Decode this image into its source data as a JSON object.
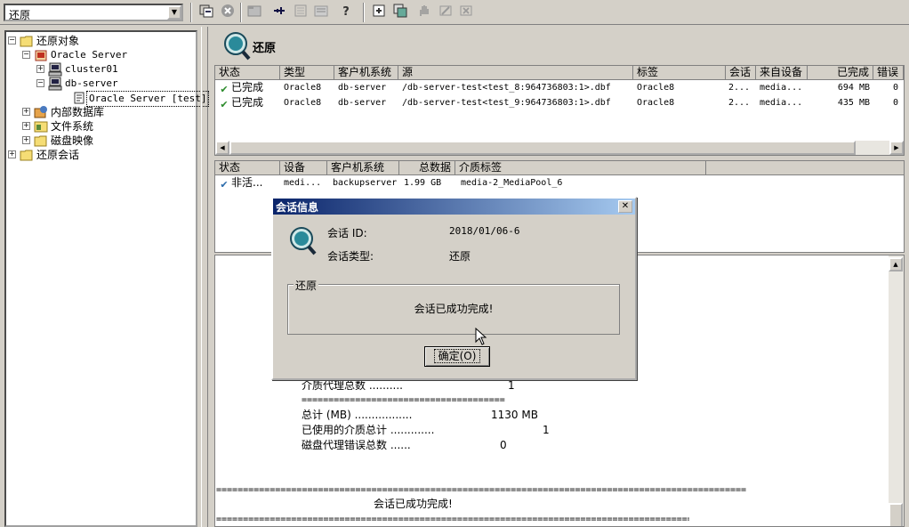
{
  "toolbar": {
    "context": "还原",
    "help_label": "?",
    "buttons": [
      "restore-icon",
      "stop-icon",
      "open-icon",
      "pin-icon",
      "properties-icon",
      "report-icon",
      "help-icon",
      "move-icon",
      "copy-icon",
      "hand-icon",
      "edit-icon",
      "delete-icon"
    ]
  },
  "tree": {
    "root": "还原对象",
    "oracle": "Oracle Server",
    "cluster": "cluster01",
    "dbserver": "db-server",
    "instance": "Oracle Server [test]",
    "internal_db": "内部数据库",
    "filesystem": "文件系统",
    "diskimage": "磁盘映像",
    "sessions": "还原会话"
  },
  "header": {
    "title": "还原"
  },
  "objects_table": {
    "columns": [
      "状态",
      "类型",
      "客户机系统",
      "源",
      "标签",
      "会话",
      "来自设备",
      "已完成",
      "错误"
    ],
    "rows": [
      {
        "status": "已完成",
        "type": "Oracle8",
        "client": "db-server",
        "source": "/db-server-test<test_8:964736803:1>.dbf",
        "label": "Oracle8",
        "session": "2...",
        "device": "media...",
        "done": "694  MB",
        "errors": "0"
      },
      {
        "status": "已完成",
        "type": "Oracle8",
        "client": "db-server",
        "source": "/db-server-test<test_9:964736803:1>.dbf",
        "label": "Oracle8",
        "session": "2...",
        "device": "media...",
        "done": "435  MB",
        "errors": "0"
      }
    ]
  },
  "devices_table": {
    "columns": [
      "状态",
      "设备",
      "客户机系统",
      "总数据",
      "介质标签"
    ],
    "rows": [
      {
        "status": "非活...",
        "device": "medi...",
        "client": "backupserver",
        "total": "1.99  GB",
        "media": "media-2_MediaPool_6"
      }
    ]
  },
  "log": {
    "media_agents_label": "介质代理总数 ..........",
    "media_agents_value": "1",
    "separator_short": "======================================",
    "total_label": "总计 (MB) .................",
    "total_value": "1130 MB",
    "used_media_label": "已使用的介质总计 .............",
    "used_media_value": "1",
    "disk_errors_label": "磁盘代理错误总数 ......",
    "disk_errors_value": "0",
    "separator_long": "===================================================================================================",
    "completed_msg": "会话已成功完成!",
    "separator_bottom": "========================================================================================="
  },
  "dialog": {
    "title": "会话信息",
    "close": "✕",
    "session_id_label": "会话 ID:",
    "session_id": "2018/01/06-6",
    "session_type_label": "会话类型:",
    "session_type": "还原",
    "group_label": "还原",
    "message": "会话已成功完成!",
    "ok": "确定(O)"
  }
}
